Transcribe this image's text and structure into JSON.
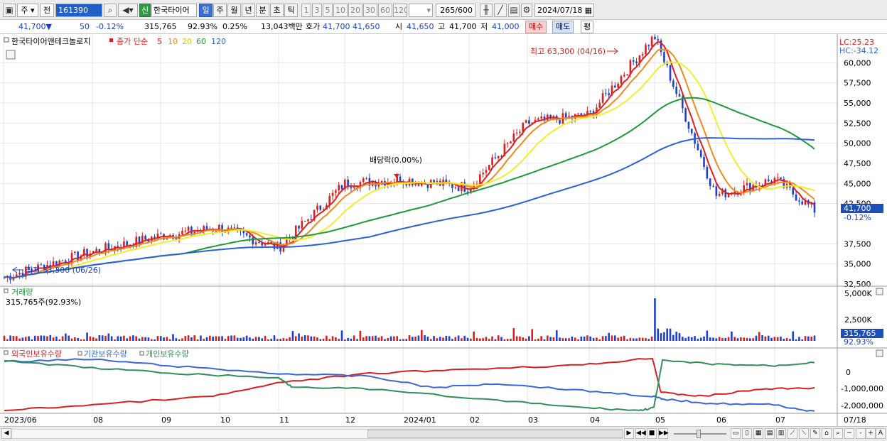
{
  "toolbar": {
    "period_label": "주",
    "compare_label": "전",
    "code": "161390",
    "badge": "신",
    "stock_name": "한국타이어",
    "timeframes": [
      "일",
      "주",
      "월",
      "년",
      "분",
      "초",
      "틱"
    ],
    "active_timeframe": "일",
    "minute_options": [
      "1",
      "3",
      "5",
      "10",
      "20",
      "30",
      "60",
      "120"
    ],
    "count": "265",
    "count_total": "/600",
    "date": "2024/07/18"
  },
  "infobar": {
    "price": "41,700▼",
    "change": "50",
    "change_pct": "-0.12%",
    "volume": "315,765",
    "vol_ratio": "92.93%",
    "turnover": "0.25%",
    "amount": "13,043백만",
    "ask_label": "호가",
    "ask1": "41,700",
    "ask2": "41,650",
    "open_label": "시",
    "open": "41,650",
    "high_label": "고",
    "high": "41,700",
    "low_label": "저",
    "low": "41,000",
    "buy_label": "매수",
    "sell_label": "매도",
    "flat_label": "평"
  },
  "price_panel": {
    "legend_name": "한국타이어앤테크놀로지",
    "legend_prefix": "종가 단순",
    "ma_periods": [
      "5",
      "10",
      "20",
      "60",
      "120"
    ],
    "ma_colors": [
      "#e0201f",
      "#f08a1c",
      "#f2ee2a",
      "#1f9a3a",
      "#2f5fd8"
    ],
    "lc_label": "LC:25.23",
    "hc_label": "HC:-34.12",
    "high_annotation": "최고 63,300 (04/16)",
    "low_annotation": "최저 33,300 (06/26)",
    "dividend_annotation": "배당락(0.00%)",
    "current_price_tag": "41,700",
    "current_change_tag": "-0.12%",
    "y_ticks": [
      "60,000",
      "57,500",
      "55,000",
      "52,500",
      "50,000",
      "47,500",
      "45,000",
      "42,500",
      "37,500",
      "35,000",
      "32,500"
    ]
  },
  "volume_panel": {
    "title": "거래량",
    "summary": "315,765주(92.93%)",
    "y_ticks": [
      "5,000K",
      "2,500K"
    ],
    "current_tag": "315,765",
    "current_pct": "92.93%"
  },
  "holdings_panel": {
    "legend": [
      "외국인보유수량",
      "기관보유수량",
      "개인보유수량"
    ],
    "colors": [
      "#d81f1f",
      "#3a66d8",
      "#2f8f5a"
    ],
    "y_ticks": [
      "0",
      "-1,000,000",
      "-2,000,000"
    ]
  },
  "x_axis": [
    "2023/06",
    "08",
    "09",
    "10",
    "11",
    "12",
    "2024/01",
    "02",
    "03",
    "04",
    "05",
    "06",
    "07",
    "07/18"
  ],
  "chart_data": {
    "type": "candlestick",
    "price_series_approx": {
      "dates": [
        "2023/06",
        "2023/07",
        "2023/08",
        "2023/09",
        "2023/10",
        "2023/11",
        "2023/12",
        "2024/01",
        "2024/02",
        "2024/03",
        "2024/04",
        "2024/05",
        "2024/06",
        "2024/07/18"
      ],
      "close": [
        33300,
        36500,
        38500,
        39500,
        37000,
        45000,
        45500,
        44500,
        52500,
        53500,
        63300,
        43500,
        45500,
        41700
      ]
    },
    "ma_series": [
      "5",
      "10",
      "20",
      "60",
      "120"
    ],
    "high": {
      "value": 63300,
      "date": "04/16"
    },
    "low": {
      "value": 33300,
      "date": "06/26"
    },
    "y_range": [
      32500,
      62500
    ]
  }
}
